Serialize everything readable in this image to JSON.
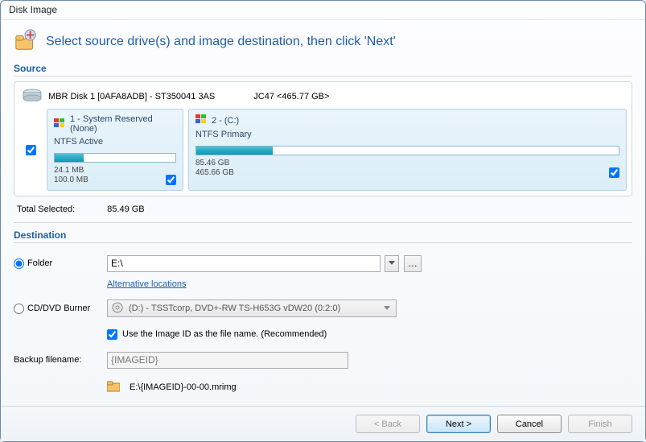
{
  "window": {
    "title": "Disk Image"
  },
  "header": {
    "title": "Select source drive(s) and image destination, then click 'Next'"
  },
  "source": {
    "label": "Source",
    "disk": {
      "name": "MBR Disk 1 [0AFA8ADB] - ST350041 3AS",
      "extra": "JC47  <465.77 GB>",
      "checked": true
    },
    "partitions": [
      {
        "title": "1 - System Reserved (None)",
        "fs": "NTFS Active",
        "used": "24.1 MB",
        "total": "100.0 MB",
        "fill_pct": 24,
        "checked": true
      },
      {
        "title": "2 -  (C:)",
        "fs": "NTFS Primary",
        "used": "85.46 GB",
        "total": "465.66 GB",
        "fill_pct": 18,
        "checked": true
      }
    ],
    "total_label": "Total Selected:",
    "total_value": "85.49 GB"
  },
  "dest": {
    "label": "Destination",
    "folder_label": "Folder",
    "folder_value": "E:\\",
    "alt_locations": "Alternative locations",
    "burner_label": "CD/DVD Burner",
    "burner_value": "(D:) - TSSTcorp, DVD+-RW TS-H653G vDW20 (0:2:0)",
    "use_imageid_label": "Use the Image ID as the file name.  (Recommended)",
    "use_imageid_checked": true,
    "backup_label": "Backup filename:",
    "backup_value": "{IMAGEID}",
    "result_path": "E:\\{IMAGEID}-00-00.mrimg",
    "dest_choice": "folder"
  },
  "buttons": {
    "back": "< Back",
    "next": "Next >",
    "cancel": "Cancel",
    "finish": "Finish"
  }
}
